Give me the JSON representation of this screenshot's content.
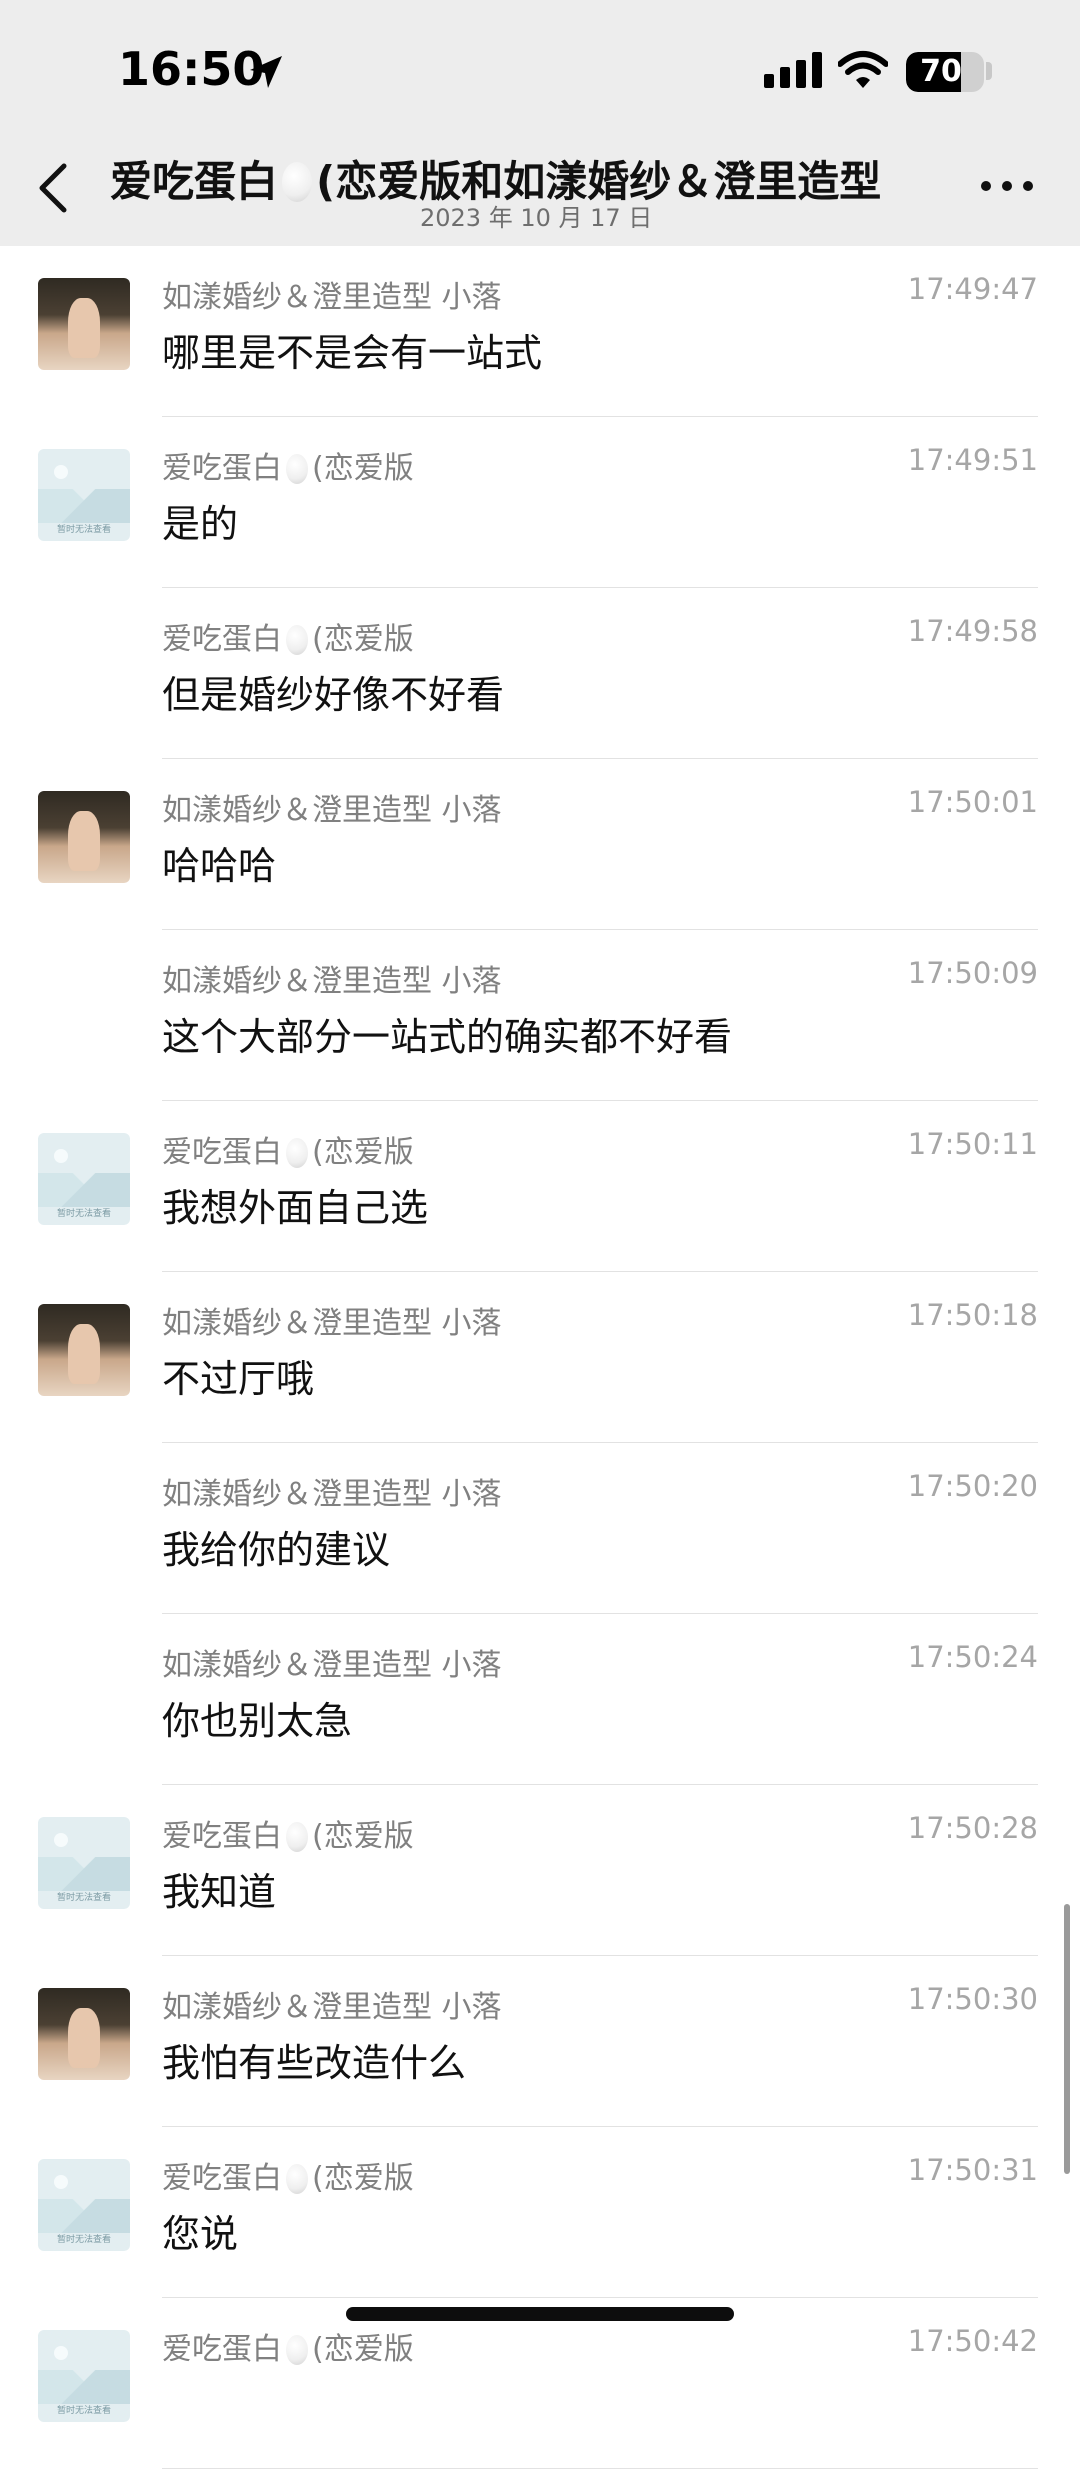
{
  "status_bar": {
    "time": "16:50",
    "battery": "70",
    "battery_level": 0.7
  },
  "header": {
    "title_prefix": "爱吃蛋白",
    "title_suffix": "(恋爱版和如漾婚纱＆澄里造型",
    "date": "2023 年 10 月 17 日"
  },
  "messages": [
    {
      "sender": "如漾婚纱＆澄里造型 小落",
      "time": "17:49:47",
      "text": "哪里是不是会有一站式",
      "avatar": "photo"
    },
    {
      "sender": "爱吃蛋白",
      "sender_suffix": "(恋爱版",
      "time": "17:49:51",
      "text": "是的",
      "avatar": "placeholder"
    },
    {
      "sender": "爱吃蛋白",
      "sender_suffix": "(恋爱版",
      "time": "17:49:58",
      "text": "但是婚纱好像不好看",
      "avatar": "none"
    },
    {
      "sender": "如漾婚纱＆澄里造型 小落",
      "time": "17:50:01",
      "text": "哈哈哈",
      "avatar": "photo"
    },
    {
      "sender": "如漾婚纱＆澄里造型 小落",
      "time": "17:50:09",
      "text": "这个大部分一站式的确实都不好看",
      "avatar": "none"
    },
    {
      "sender": "爱吃蛋白",
      "sender_suffix": "(恋爱版",
      "time": "17:50:11",
      "text": "我想外面自己选",
      "avatar": "placeholder"
    },
    {
      "sender": "如漾婚纱＆澄里造型 小落",
      "time": "17:50:18",
      "text": "不过厅哦",
      "avatar": "photo"
    },
    {
      "sender": "如漾婚纱＆澄里造型 小落",
      "time": "17:50:20",
      "text": "我给你的建议",
      "avatar": "none"
    },
    {
      "sender": "如漾婚纱＆澄里造型 小落",
      "time": "17:50:24",
      "text": "你也别太急",
      "avatar": "none"
    },
    {
      "sender": "爱吃蛋白",
      "sender_suffix": "(恋爱版",
      "time": "17:50:28",
      "text": "我知道",
      "avatar": "placeholder"
    },
    {
      "sender": "如漾婚纱＆澄里造型 小落",
      "time": "17:50:30",
      "text": "我怕有些改造什么",
      "avatar": "photo"
    },
    {
      "sender": "爱吃蛋白",
      "sender_suffix": "(恋爱版",
      "time": "17:50:31",
      "text": "您说",
      "avatar": "placeholder"
    },
    {
      "sender": "爱吃蛋白",
      "sender_suffix": "(恋爱版",
      "time": "17:50:42",
      "text": "",
      "avatar": "placeholder"
    }
  ],
  "placeholder_label": "暂时无法查看",
  "colors": {
    "header_bg": "#ededed",
    "sender": "#808080",
    "time": "#a6a6a6"
  },
  "icons": [
    "back-icon",
    "more-icon",
    "location-arrow-icon",
    "signal-icon",
    "wifi-icon",
    "battery-icon"
  ]
}
